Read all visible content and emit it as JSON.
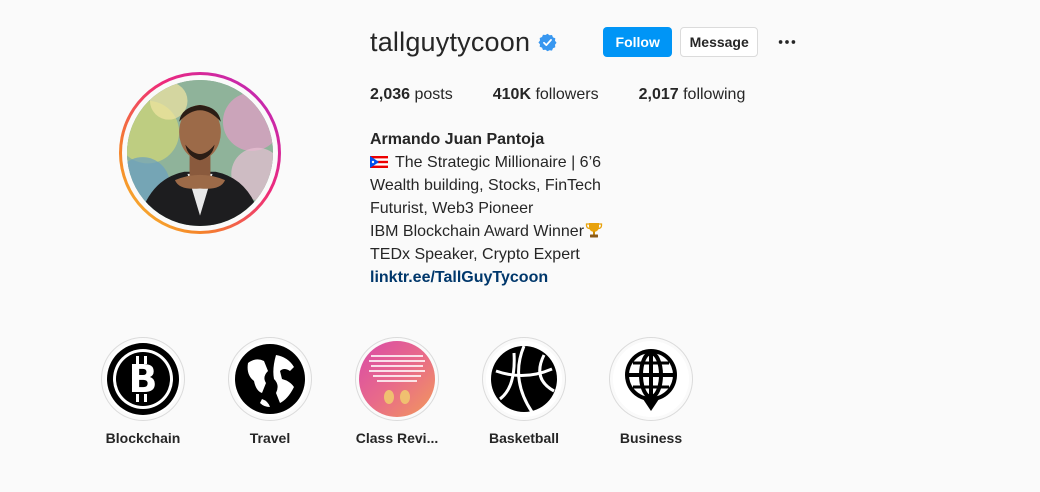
{
  "profile": {
    "username": "tallguytycoon",
    "follow_label": "Follow",
    "message_label": "Message",
    "more_icon": "more-options-icon",
    "verified_icon": "verified-badge-icon"
  },
  "stats": {
    "posts_count": "2,036",
    "posts_label": "posts",
    "followers_count": "410K",
    "followers_label": "followers",
    "following_count": "2,017",
    "following_label": "following"
  },
  "bio": {
    "name": "Armando Juan Pantoja",
    "line1": "The Strategic Millionaire | 6’6",
    "line2": "Wealth building, Stocks, FinTech",
    "line3": "Futurist, Web3 Pioneer",
    "line4": "IBM Blockchain Award Winner",
    "line5": "TEDx Speaker, Crypto Expert",
    "link": "linktr.ee/TallGuyTycoon"
  },
  "highlights": [
    {
      "label": "Blockchain",
      "icon": "bitcoin-icon"
    },
    {
      "label": "Travel",
      "icon": "globe-icon"
    },
    {
      "label": "Class Revi...",
      "icon": "class-review-thumbnail"
    },
    {
      "label": "Basketball",
      "icon": "basketball-icon"
    },
    {
      "label": "Business",
      "icon": "business-globe-icon"
    }
  ],
  "colors": {
    "follow_button": "#0095f6",
    "link": "#00376b",
    "verified": "#3897f0",
    "background": "#fafafa"
  }
}
